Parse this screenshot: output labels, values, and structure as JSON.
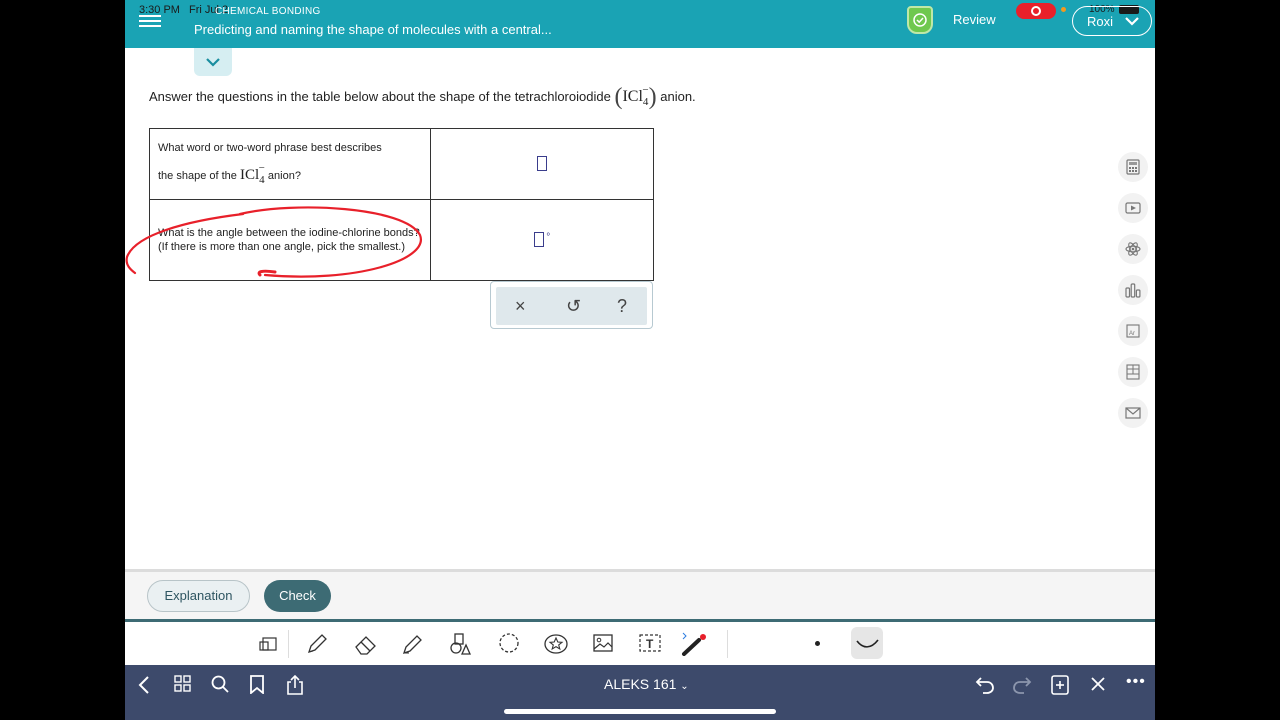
{
  "status_bar": {
    "time": "3:30 PM",
    "date": "Fri Jul 2",
    "battery": "100%"
  },
  "header": {
    "topic": "CHEMICAL BONDING",
    "title": "Predicting and naming the shape of molecules with a central...",
    "review_label": "Review",
    "user_name": "Roxi"
  },
  "question": {
    "prompt_before": "Answer the questions in the table below about the shape of the tetrachloroiodide",
    "prompt_after": "anion.",
    "formula": {
      "base": "ICl",
      "subscript": "4",
      "superscript": "−"
    },
    "rows": [
      {
        "question_line1": "What word or two-word phrase best describes",
        "question_line2_before": "the shape of the",
        "question_line2_after": "anion?",
        "answer": ""
      },
      {
        "question": "What is the angle between the iodine-chlorine bonds? (If there is more than one angle, pick the smallest.)",
        "answer": "",
        "unit": "°"
      }
    ],
    "keypad": {
      "clear": "×",
      "undo": "↺",
      "help": "?"
    }
  },
  "actions": {
    "explanation_label": "Explanation",
    "check_label": "Check"
  },
  "right_toolbar": [
    "calculator-icon",
    "video-icon",
    "atom-icon",
    "chart-icon",
    "periodic-table-icon",
    "data-icon",
    "mail-icon"
  ],
  "drawing_toolbar": [
    "lasso-crop-icon",
    "pen-icon",
    "eraser-icon",
    "highlighter-icon",
    "shapes-icon",
    "lasso-icon",
    "sticker-icon",
    "image-icon",
    "text-icon",
    "bluetooth-pen-icon"
  ],
  "nav": {
    "doc_title": "ALEKS 161"
  },
  "colors": {
    "header": "#1aa3b4",
    "check_button": "#3d6b74",
    "nav": "#3d4a6b",
    "annotation": "#e8202a"
  }
}
